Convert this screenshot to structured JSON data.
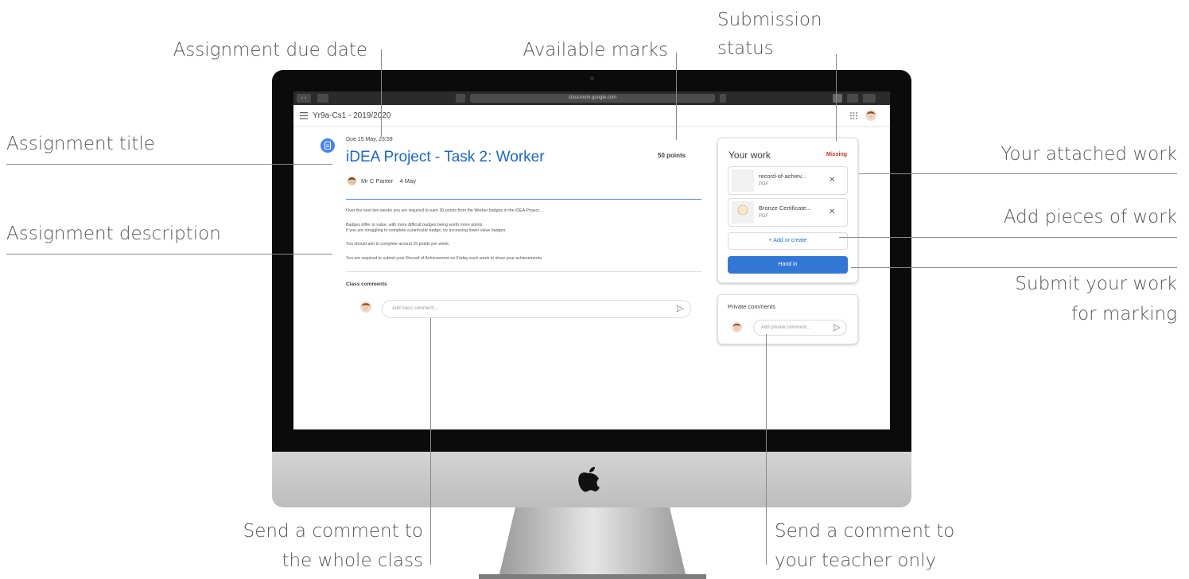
{
  "annotations": {
    "due_date": "Assignment due date",
    "marks": "Available marks",
    "status_line1": "Submission",
    "status_line2": "status",
    "title": "Assignment title",
    "description": "Assignment description",
    "attached": "Your attached work",
    "add": "Add pieces of work",
    "submit_line1": "Submit your work",
    "submit_line2": "for marking",
    "class_comment_line1": "Send a comment to",
    "class_comment_line2": "the whole class",
    "private_comment_line1": "Send a comment to",
    "private_comment_line2": "your teacher only"
  },
  "browser": {
    "url": "classroom.google.com"
  },
  "header": {
    "class_name": "Yr9a-Cs1 - 2019/2020"
  },
  "assignment": {
    "due": "Due 15 May, 23:59",
    "title": "iDEA Project - Task 2: Worker",
    "points": "50 points",
    "author": "Mr C Panter",
    "posted": "4 May",
    "description": [
      "Over the next two weeks you are required to earn 30 points from the Worker badges in the iDEA Project.",
      "Badges differ in value, with more difficult badges being worth more points.",
      "If you are struggling to complete a particular badge, try accessing lower value badges.",
      "You should aim to complete around 25 points per week.",
      "You are required to submit your Record of Achievement on Friday each week to show your achievements."
    ]
  },
  "class_comments": {
    "label": "Class comments",
    "placeholder": "Add class comment..."
  },
  "your_work": {
    "title": "Your work",
    "status": "Missing",
    "attachments": [
      {
        "name": "record-of-achiev...",
        "type": "PDF"
      },
      {
        "name": "Bronze Certificate...",
        "type": "PDF"
      }
    ],
    "add_label": "+ Add or create",
    "hand_in_label": "Hand in"
  },
  "private_comments": {
    "title": "Private comments",
    "placeholder": "Add private comment..."
  },
  "colors": {
    "accent_blue": "#1967d2",
    "hand_in_blue": "#3277d6",
    "missing_red": "#d93025"
  }
}
